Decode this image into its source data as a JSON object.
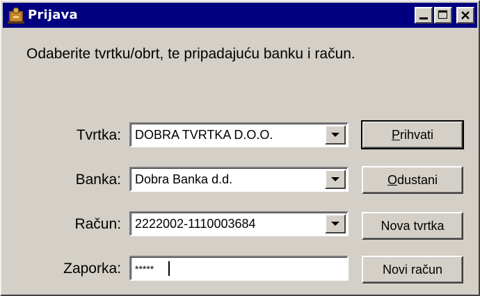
{
  "window": {
    "title": "Prijava",
    "icon": "app-icon",
    "controls": [
      "minimize-icon",
      "maximize-icon",
      "close-icon"
    ]
  },
  "instruction": "Odaberite tvrtku/obrt, te pripadajuću banku i račun.",
  "form": {
    "company_label": "Tvrtka:",
    "company_value": "DOBRA TVRTKA D.O.O.",
    "bank_label": "Banka:",
    "bank_value": "Dobra Banka d.d.",
    "account_label": "Račun:",
    "account_value": "2222002-1110003684",
    "password_label": "Zaporka:",
    "password_value": "*****"
  },
  "buttons": {
    "accept_mnemonic": "P",
    "accept_rest": "rihvati",
    "cancel_mnemonic": "O",
    "cancel_rest": "dustani",
    "new_company": "Nova tvrtka",
    "new_account": "Novi račun"
  },
  "colors": {
    "titlebar": "#000080",
    "face": "#d4d0c8"
  }
}
